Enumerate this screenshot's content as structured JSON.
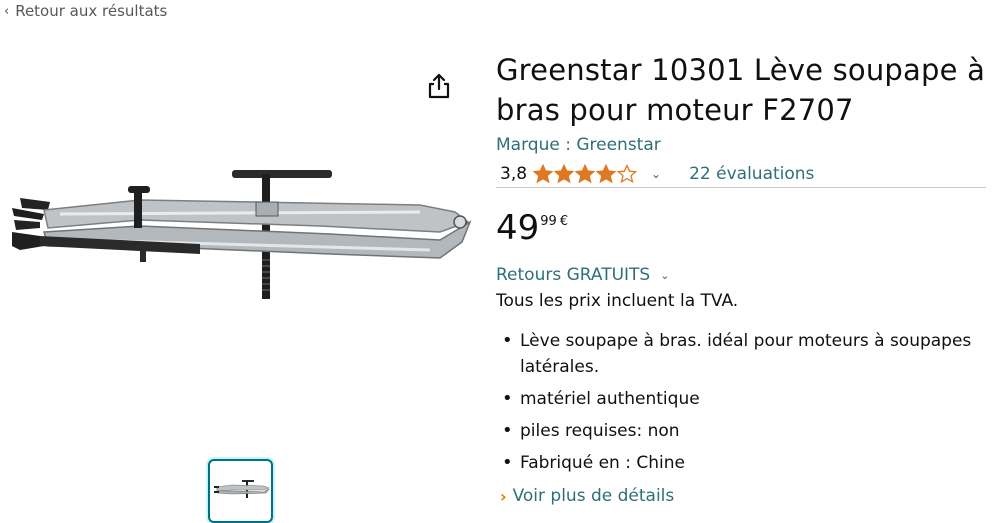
{
  "nav": {
    "back_label": "Retour aux résultats"
  },
  "product": {
    "title": "Greenstar 10301 Lève soupape à bras pour moteur F2707",
    "brand": "Marque : Greenstar",
    "rating": "3,8",
    "rating_value": 3.8,
    "reviews": "22 évaluations",
    "price_whole": "49",
    "price_fraction": "99",
    "currency": "€",
    "returns": "Retours GRATUITS",
    "tax_note": "Tous les prix incluent la TVA.",
    "bullets": [
      "Lève soupape à bras. idéal pour moteurs à soupapes latérales.",
      "matériel authentique",
      "piles requises: non",
      "Fabriqué en : Chine"
    ],
    "more_details": "Voir plus de détails"
  },
  "icons": {
    "back": "chevron-left-icon",
    "share": "share-icon",
    "rating_dropdown": "chevron-down-icon",
    "returns_dropdown": "chevron-down-icon",
    "more": "chevron-right-icon"
  },
  "colors": {
    "link": "#2f6f7a",
    "star": "#de7921",
    "thumb_border": "#007185",
    "more_arrow": "#e77600"
  }
}
